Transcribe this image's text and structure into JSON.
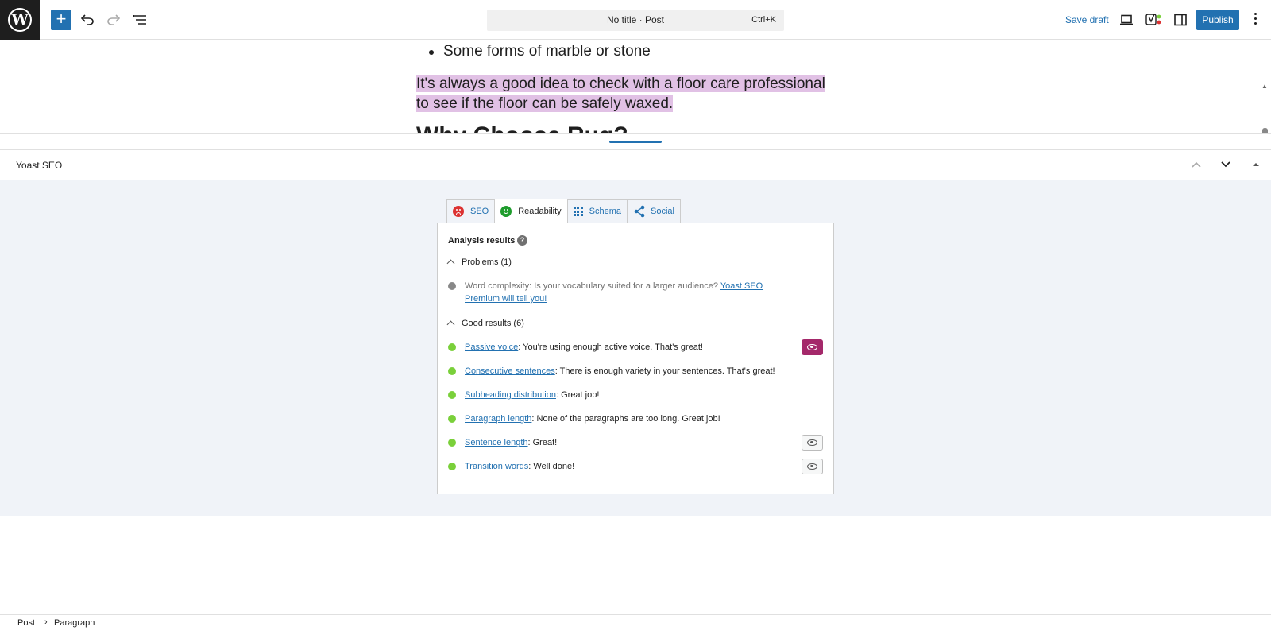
{
  "topbar": {
    "logo": "W",
    "add_label": "+",
    "icons": [
      "undo-icon",
      "redo-icon",
      "list-view-icon",
      "preview-device-icon",
      "yoast-icon",
      "sidebar-toggle-icon",
      "options-icon"
    ],
    "document_title": "No title · Post",
    "shortcut": "Ctrl+K",
    "save_draft": "Save draft",
    "publish": "Publish"
  },
  "editor": {
    "list_item": "Some forms of marble or stone",
    "paragraph": "It's always a good idea to check with a floor care professional to see if the floor can be safely waxed.",
    "heading_partial": "Why Choose Rug?",
    "highlight_color": "#e1c1e5"
  },
  "yoast": {
    "title": "Yoast SEO",
    "tabs": [
      {
        "label": "SEO",
        "icon": "sad-face-icon",
        "color": "#dc3232"
      },
      {
        "label": "Readability",
        "icon": "smiley-face-icon",
        "color": "#1f9c2d"
      },
      {
        "label": "Schema",
        "icon": "grid-icon"
      },
      {
        "label": "Social",
        "icon": "share-icon"
      }
    ],
    "analysis_title": "Analysis results",
    "help": "?",
    "problems_heading": "Problems (1)",
    "problem": {
      "text": "Word complexity: Is your vocabulary suited for a larger audience? ",
      "link": "Yoast SEO Premium will tell you!"
    },
    "good_heading": "Good results (6)",
    "good": [
      {
        "link": "Passive voice",
        "text": ": You're using enough active voice. That's great!"
      },
      {
        "link": "Consecutive sentences",
        "text": ": There is enough variety in your sentences. That's great!"
      },
      {
        "link": "Subheading distribution",
        "text": ": Great job!"
      },
      {
        "link": "Paragraph length",
        "text": ": None of the paragraphs are too long. Great job!"
      },
      {
        "link": "Sentence length",
        "text": ": Great!"
      },
      {
        "link": "Transition words",
        "text": ": Well done!"
      }
    ],
    "colors": {
      "accent": "#2271b1",
      "good": "#7ad03a",
      "eye_active": "#a4286a"
    }
  },
  "footer": {
    "crumb_1": "Post",
    "separator": "›",
    "crumb_2": "Paragraph"
  }
}
